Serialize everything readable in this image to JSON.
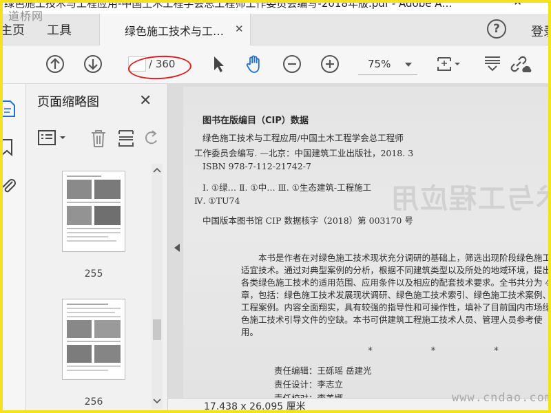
{
  "window": {
    "title": "绿色施工技术与工程应用-中国土木工程学会总工程师工作委员会编写-2018年版.pdf - Adobe A…",
    "close_glyph": "✕"
  },
  "watermarks": {
    "top_left": "道桥网",
    "bottom_right": "www.cndao.com"
  },
  "tabs": {
    "home": "主页",
    "tools": "工具",
    "document": "绿色施工技术与工…",
    "document_close": "✕"
  },
  "header_right": {
    "login": "登录"
  },
  "toolbar": {
    "page_current": "",
    "page_total": "/ 360",
    "zoom": "75%"
  },
  "icons": {
    "prev_page": "arrow-up-circle",
    "next_page": "arrow-down-circle",
    "select_tool": "cursor-arrow",
    "hand_tool": "hand",
    "zoom_out": "minus-circle",
    "zoom_in": "plus-circle",
    "fit_page": "fit-page-scroll",
    "page_display": "page-display",
    "share_link": "link-cloud"
  },
  "panel": {
    "title": "页面缩略图",
    "close": "✕",
    "thumbnails": [
      {
        "label": "255"
      },
      {
        "label": "256"
      }
    ]
  },
  "document": {
    "cip_heading": "图书在版编目（CIP）数据",
    "cip_lines": [
      "绿色施工技术与工程应用/中国土木工程学会总工程师",
      "工作委员会编写. —北京：中国建筑工业出版社，2018. 3",
      "ISBN 978-7-112-21742-7",
      "Ⅰ. ①绿…  Ⅱ. ①中…  Ⅲ. ①生态建筑-工程施工",
      "Ⅳ. ①TU74"
    ],
    "cip_number": "中国版本图书馆 CIP 数据核字（2018）第 003170 号",
    "summary": "本书是作者在对绿色施工技术现状充分调研的基础上，筛选出现阶段绿色施工适宜技术。通过对典型案例的分析，根据不同建筑类型以及所处的地域环境，提出各类绿色施工技术的适用范围、应用条件以及相应的配套技术要求。全书共分为 4 章，包括：绿色施工技术发展现状调研、绿色施工技术索引、绿色施工技术案例、工程案例。内容全面翔实，具有较强的指导性和可操作性，填补了目前国内市场绿色施工技术引导文件的空缺。本书可供建筑工程施工技术人员、管理人员参考使用。",
    "stars": "* * *",
    "credits": [
      "责任编辑：王砾瑶    岳建光",
      "责任设计：李志立",
      "责任校对：李美娜"
    ],
    "bleed_text": "绿色施工技术与工程应用"
  },
  "status": {
    "dimensions": "17.438 x 26.095 厘米"
  }
}
